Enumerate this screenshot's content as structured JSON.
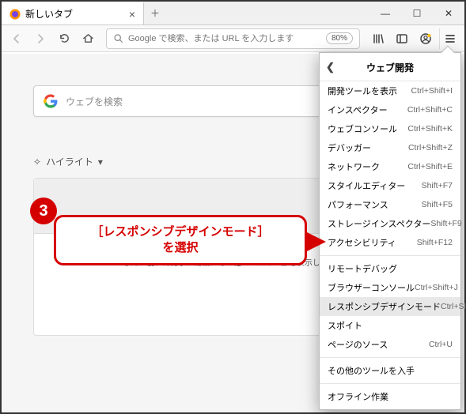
{
  "window": {
    "tab_title": "新しいタブ"
  },
  "toolbar": {
    "search_placeholder": "Google で検索、または URL を入力します",
    "zoom": "80%"
  },
  "content": {
    "search_placeholder": "ウェブを検索",
    "highlights_label": "ハイライト",
    "card_text": "した、優れた記事、動画、その他ページの一部を表示します。"
  },
  "menu": {
    "header": "ウェブ開発",
    "groups": [
      [
        {
          "label": "開発ツールを表示",
          "shortcut": "Ctrl+Shift+I"
        },
        {
          "label": "インスペクター",
          "shortcut": "Ctrl+Shift+C"
        },
        {
          "label": "ウェブコンソール",
          "shortcut": "Ctrl+Shift+K"
        },
        {
          "label": "デバッガー",
          "shortcut": "Ctrl+Shift+Z"
        },
        {
          "label": "ネットワーク",
          "shortcut": "Ctrl+Shift+E"
        },
        {
          "label": "スタイルエディター",
          "shortcut": "Shift+F7"
        },
        {
          "label": "パフォーマンス",
          "shortcut": "Shift+F5"
        },
        {
          "label": "ストレージインスペクター",
          "shortcut": "Shift+F9"
        },
        {
          "label": "アクセシビリティ",
          "shortcut": "Shift+F12"
        }
      ],
      [
        {
          "label": "リモートデバッグ",
          "shortcut": ""
        },
        {
          "label": "ブラウザーコンソール",
          "shortcut": "Ctrl+Shift+J"
        },
        {
          "label": "レスポンシブデザインモード",
          "shortcut": "Ctrl+Shift+M",
          "highlight": true
        },
        {
          "label": "スポイト",
          "shortcut": ""
        },
        {
          "label": "ページのソース",
          "shortcut": "Ctrl+U"
        }
      ],
      [
        {
          "label": "その他のツールを入手",
          "shortcut": ""
        }
      ],
      [
        {
          "label": "オフライン作業",
          "shortcut": ""
        }
      ]
    ]
  },
  "annotation": {
    "number": "3",
    "text": "［レスポンシブデザインモード］\nを選択"
  }
}
